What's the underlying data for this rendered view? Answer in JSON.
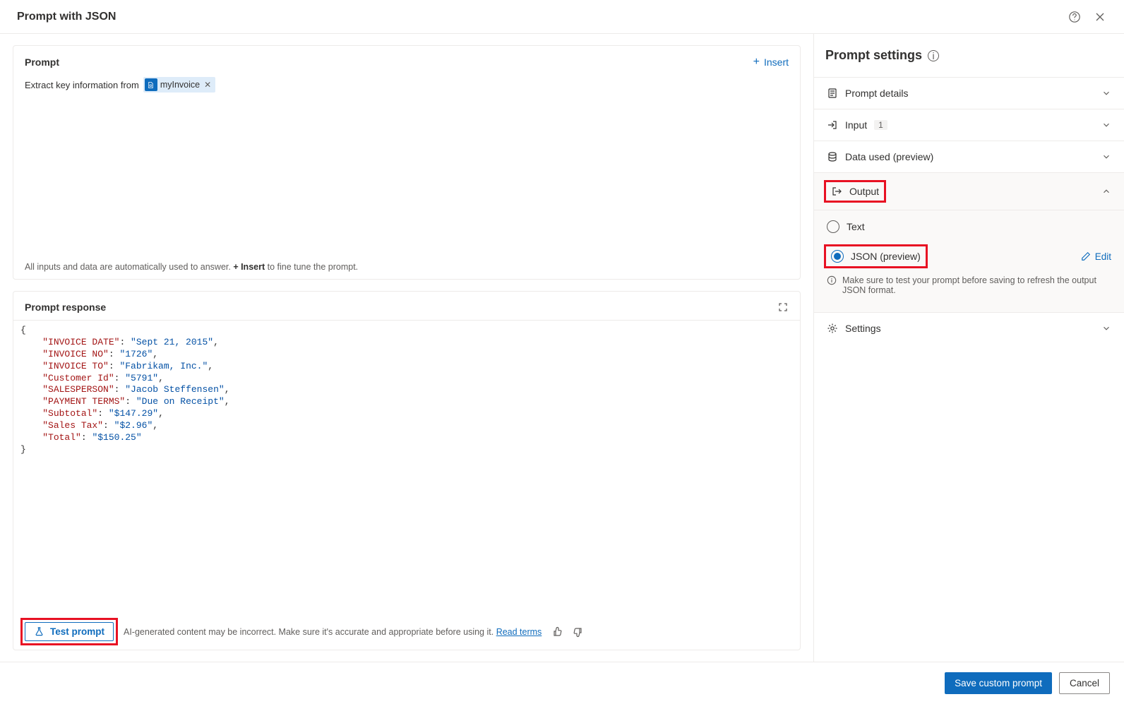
{
  "header": {
    "title": "Prompt with JSON"
  },
  "prompt": {
    "card_title": "Prompt",
    "insert_label": "Insert",
    "prefix_text": "Extract key information from",
    "chip_label": "myInvoice",
    "footer_pre": "All inputs and data are automatically used to answer. ",
    "footer_bold": "+ Insert",
    "footer_post": " to fine tune the prompt."
  },
  "response": {
    "card_title": "Prompt response",
    "json": {
      "INVOICE DATE": "Sept 21, 2015",
      "INVOICE NO": "1726",
      "INVOICE TO": "Fabrikam, Inc.",
      "Customer Id": "5791",
      "SALESPERSON": "Jacob Steffensen",
      "PAYMENT TERMS": "Due on Receipt",
      "Subtotal": "$147.29",
      "Sales Tax": "$2.96",
      "Total": "$150.25"
    },
    "test_label": "Test prompt",
    "disclaimer_text": "AI-generated content may be incorrect. Make sure it's accurate and appropriate before using it.",
    "disclaimer_link": "Read terms"
  },
  "sidebar": {
    "title": "Prompt settings",
    "sections": {
      "details": "Prompt details",
      "input": "Input",
      "input_badge": "1",
      "data_used": "Data used (preview)",
      "output": "Output",
      "settings": "Settings"
    },
    "output": {
      "text_label": "Text",
      "json_label": "JSON (preview)",
      "edit_label": "Edit",
      "note": "Make sure to test your prompt before saving to refresh the output JSON format."
    }
  },
  "footer": {
    "save": "Save custom prompt",
    "cancel": "Cancel"
  }
}
